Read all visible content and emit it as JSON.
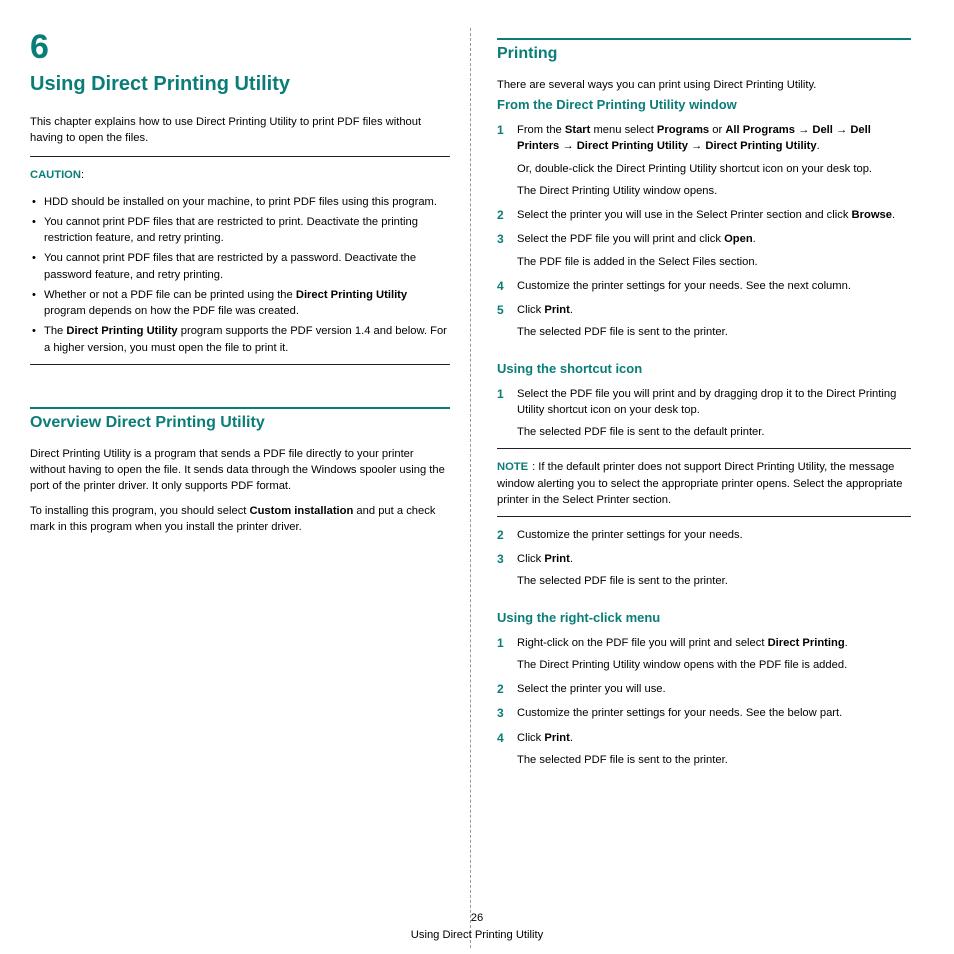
{
  "chapter": {
    "number": "6",
    "title": "Using Direct Printing Utility"
  },
  "intro": "This chapter explains how to use Direct Printing Utility to print PDF files without having to open the files.",
  "caution_label": "CAUTION",
  "cautions": [
    "HDD should be installed on your machine, to print PDF files using this program.",
    "You cannot print PDF files that are restricted to print. Deactivate the printing restriction feature, and retry printing.",
    "You cannot print PDF files that are restricted by a password. Deactivate the password feature, and retry printing."
  ],
  "caution4": {
    "pre": "Whether or not a PDF file can be printed using the ",
    "b": "Direct Printing Utility",
    "post": " program depends on how the PDF file was created."
  },
  "caution5": {
    "pre": "The ",
    "b": "Direct Printing Utility",
    "post": " program supports the PDF version 1.4 and below. For a higher version, you must open the file to print it."
  },
  "overview_title": "Overview Direct Printing Utility",
  "overview_p1": "Direct Printing Utility is a program that sends a PDF file directly to your printer without having to open the file. It sends data through the Windows spooler using the port of the printer driver. It only supports PDF format.",
  "overview_p2": {
    "pre": "To installing this program, you should select ",
    "b": "Custom installation",
    "post": " and put a check mark in this program when you install the printer driver."
  },
  "printing_title": "Printing",
  "printing_intro": "There are several ways you can print using Direct Printing Utility.",
  "sub_window": "From the Direct Printing Utility window",
  "step1": {
    "t1": "From the ",
    "b1": "Start",
    "t2": " menu select ",
    "b2": "Programs",
    "t3": " or ",
    "b3": "All Programs",
    "arrow1": " → ",
    "b4": "Dell",
    "arrow2": " → ",
    "b5": "Dell Printers",
    "arrow3": " → ",
    "b6": "Direct Printing Utility",
    "arrow4": " → ",
    "b7": "Direct Printing Utility",
    "t4": "."
  },
  "step1b": "Or, double-click the Direct Printing Utility shortcut icon on your desk top.",
  "step1c": "The Direct Printing Utility window opens.",
  "step2": {
    "pre": "Select the printer you will use in the Select Printer section and click ",
    "b": "Browse",
    "post": "."
  },
  "step3": {
    "pre": "Select the PDF file you will print and click ",
    "b": "Open",
    "post": "."
  },
  "step3b": "The PDF file is added in the Select Files section.",
  "step4": "Customize the printer settings for your needs. See the next column.",
  "step5": {
    "pre": "Click ",
    "b": "Print",
    "post": "."
  },
  "step5b": "The selected PDF file is sent to the printer.",
  "sub_shortcut": "Using the shortcut icon",
  "sc1": "Select the PDF file you will print and by dragging drop it to the Direct Printing Utility shortcut icon on your desk top.",
  "sc1b": "The selected PDF file is sent to the default printer.",
  "note_label": "NOTE",
  "note_text": " If the default printer does not support Direct Printing Utility, the message window alerting you to select the appropriate printer opens. Select the appropriate printer in the Select Printer section.",
  "sc2": "Customize the printer settings for your needs.",
  "sc3": {
    "pre": "Click ",
    "b": "Print",
    "post": "."
  },
  "sc3b": "The selected PDF file is sent to the printer.",
  "sub_rc": "Using the right-click menu",
  "rc1": {
    "pre": "Right-click on the PDF file you will print and select ",
    "b": "Direct Printing",
    "post": "."
  },
  "rc1b": "The Direct Printing Utility window opens with the PDF file is added.",
  "rc2": "Select the printer you will use.",
  "rc3": "Customize the printer settings for your needs. See the below part.",
  "rc4": {
    "pre": "Click ",
    "b": "Print",
    "post": "."
  },
  "rc4b": "The selected PDF file is sent to the printer.",
  "footer": {
    "num": "26",
    "text": "Using Direct Printing Utility"
  }
}
